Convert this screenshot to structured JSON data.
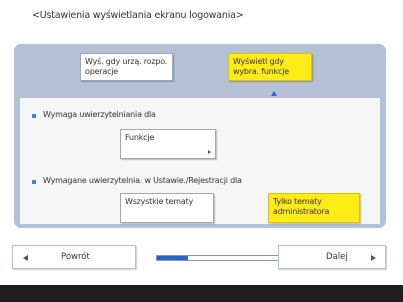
{
  "title": "<Ustawienia wyświetlania ekranu logowania>",
  "options": {
    "device_op": "Wyś. gdy urzą. rozpo. operacje",
    "func_select": "Wyświetl gdy wybra. funkcje"
  },
  "section1": {
    "label": "Wymaga uwierzytelniania dla",
    "button": "Funkcje"
  },
  "section2": {
    "label": "Wymagane uwierzytelnia. w Ustawie./Rejestracji dla",
    "all_topics": "Wszystkie tematy",
    "admin_topics": "Tylko tematy administratora"
  },
  "nav": {
    "back": "Powrót",
    "next": "Dalej",
    "progress": 0.25
  },
  "colors": {
    "selected": "#ffeb16",
    "panel": "#b4c0d6",
    "accent": "#2a64c8"
  }
}
